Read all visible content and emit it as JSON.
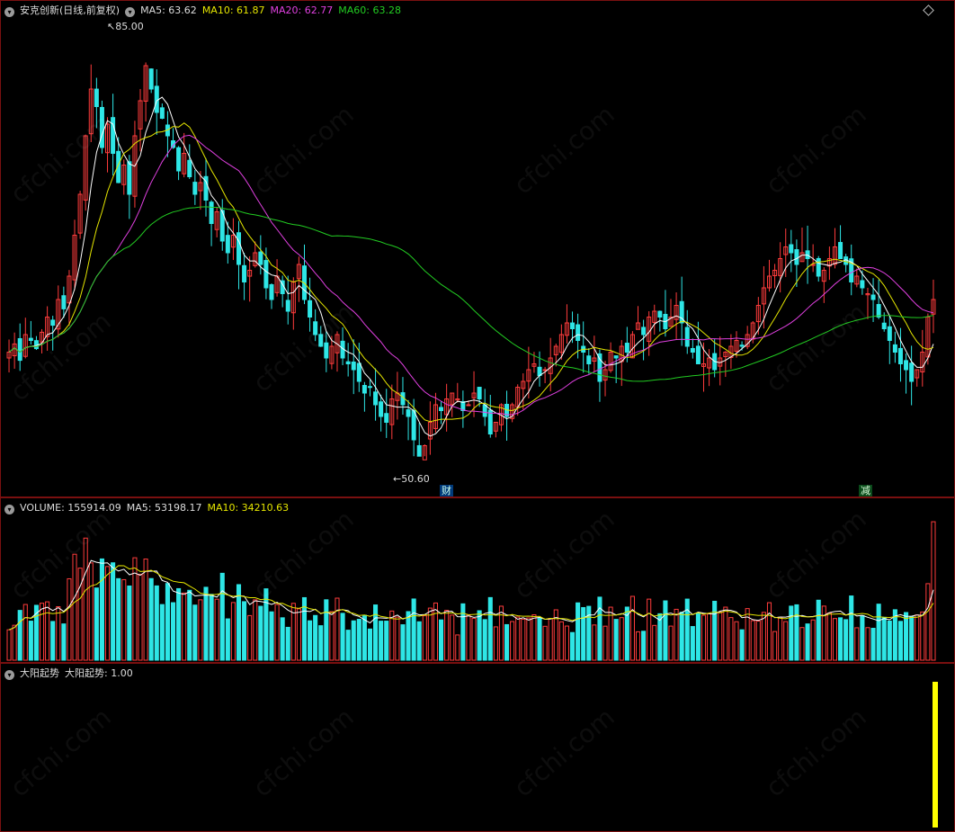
{
  "price_header": {
    "title": "安克创新(日线,前复权)",
    "ma5": "MA5: 63.62",
    "ma10": "MA10: 61.87",
    "ma20": "MA20: 62.77",
    "ma60": "MA60: 63.28"
  },
  "price_marks": {
    "high": "85.00",
    "low": "50.60"
  },
  "event_tags": {
    "cai": "财",
    "jian": "减"
  },
  "volume_header": {
    "volume": "VOLUME: 155914.09",
    "ma5": "MA5: 53198.17",
    "ma10": "MA10: 34210.63"
  },
  "indicator_header": {
    "name": "大阳起势",
    "value": "大阳起势: 1.00"
  },
  "watermark": "cfchi.com",
  "colors": {
    "up": "#ff3c3c",
    "down": "#2ee6e6",
    "ma5": "#ffffff",
    "ma10": "#e5e600",
    "ma20": "#e040e0",
    "ma60": "#22cc22",
    "panel_border": "#7a1010",
    "signal_bar": "#ffff00"
  },
  "chart_data": {
    "type": "candlestick",
    "price_range": [
      50.6,
      85.0
    ],
    "closes": [
      59.5,
      60.2,
      58.8,
      61.0,
      60.5,
      59.8,
      61.2,
      62.5,
      61.8,
      64.0,
      63.2,
      66.0,
      69.5,
      73.0,
      78.0,
      82.0,
      80.5,
      77.0,
      79.0,
      76.5,
      74.0,
      75.5,
      73.0,
      78.0,
      81.0,
      84.0,
      82.0,
      80.0,
      79.5,
      78.0,
      77.0,
      75.0,
      76.5,
      74.5,
      73.0,
      74.0,
      72.5,
      70.5,
      71.5,
      69.0,
      68.0,
      69.5,
      67.0,
      65.5,
      66.5,
      68.0,
      67.0,
      65.0,
      64.0,
      66.0,
      64.5,
      63.0,
      65.5,
      67.0,
      64.0,
      62.5,
      61.0,
      60.0,
      59.0,
      60.0,
      61.0,
      59.0,
      58.5,
      58.0,
      57.0,
      56.0,
      56.5,
      55.0,
      54.0,
      53.5,
      55.5,
      56.0,
      55.0,
      54.0,
      52.0,
      50.6,
      51.5,
      53.5,
      55.0,
      54.5,
      55.5,
      56.0,
      55.5,
      54.5,
      55.0,
      56.0,
      55.5,
      54.0,
      52.5,
      53.5,
      55.0,
      54.0,
      55.0,
      56.5,
      57.0,
      58.0,
      58.5,
      57.5,
      58.0,
      59.0,
      60.0,
      61.0,
      62.0,
      61.5,
      60.5,
      59.5,
      58.5,
      59.0,
      57.0,
      58.0,
      59.5,
      59.0,
      60.0,
      59.5,
      61.0,
      62.0,
      61.0,
      62.5,
      63.0,
      62.5,
      61.5,
      62.5,
      63.5,
      62.0,
      60.0,
      59.5,
      58.5,
      58.5,
      59.0,
      58.0,
      59.0,
      59.5,
      60.0,
      60.5,
      60.0,
      61.0,
      62.0,
      63.5,
      65.0,
      66.0,
      66.5,
      67.5,
      68.5,
      68.0,
      67.0,
      68.0,
      67.5,
      67.0,
      66.0,
      66.5,
      67.5,
      68.5,
      67.5,
      67.0,
      65.5,
      66.0,
      65.0,
      64.5,
      64.0,
      62.5,
      61.5,
      60.5,
      59.5,
      58.5,
      58.0,
      57.0,
      58.0,
      59.5,
      62.5,
      64.0
    ],
    "signal": 1.0
  }
}
